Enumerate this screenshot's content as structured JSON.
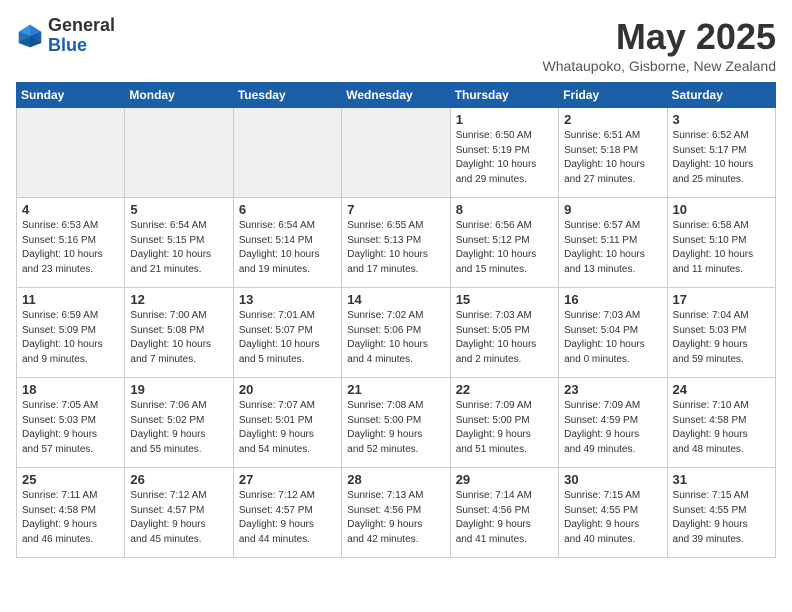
{
  "header": {
    "logo_general": "General",
    "logo_blue": "Blue",
    "month_title": "May 2025",
    "location": "Whataupoko, Gisborne, New Zealand"
  },
  "weekdays": [
    "Sunday",
    "Monday",
    "Tuesday",
    "Wednesday",
    "Thursday",
    "Friday",
    "Saturday"
  ],
  "weeks": [
    [
      {
        "day": "",
        "info": ""
      },
      {
        "day": "",
        "info": ""
      },
      {
        "day": "",
        "info": ""
      },
      {
        "day": "",
        "info": ""
      },
      {
        "day": "1",
        "info": "Sunrise: 6:50 AM\nSunset: 5:19 PM\nDaylight: 10 hours\nand 29 minutes."
      },
      {
        "day": "2",
        "info": "Sunrise: 6:51 AM\nSunset: 5:18 PM\nDaylight: 10 hours\nand 27 minutes."
      },
      {
        "day": "3",
        "info": "Sunrise: 6:52 AM\nSunset: 5:17 PM\nDaylight: 10 hours\nand 25 minutes."
      }
    ],
    [
      {
        "day": "4",
        "info": "Sunrise: 6:53 AM\nSunset: 5:16 PM\nDaylight: 10 hours\nand 23 minutes."
      },
      {
        "day": "5",
        "info": "Sunrise: 6:54 AM\nSunset: 5:15 PM\nDaylight: 10 hours\nand 21 minutes."
      },
      {
        "day": "6",
        "info": "Sunrise: 6:54 AM\nSunset: 5:14 PM\nDaylight: 10 hours\nand 19 minutes."
      },
      {
        "day": "7",
        "info": "Sunrise: 6:55 AM\nSunset: 5:13 PM\nDaylight: 10 hours\nand 17 minutes."
      },
      {
        "day": "8",
        "info": "Sunrise: 6:56 AM\nSunset: 5:12 PM\nDaylight: 10 hours\nand 15 minutes."
      },
      {
        "day": "9",
        "info": "Sunrise: 6:57 AM\nSunset: 5:11 PM\nDaylight: 10 hours\nand 13 minutes."
      },
      {
        "day": "10",
        "info": "Sunrise: 6:58 AM\nSunset: 5:10 PM\nDaylight: 10 hours\nand 11 minutes."
      }
    ],
    [
      {
        "day": "11",
        "info": "Sunrise: 6:59 AM\nSunset: 5:09 PM\nDaylight: 10 hours\nand 9 minutes."
      },
      {
        "day": "12",
        "info": "Sunrise: 7:00 AM\nSunset: 5:08 PM\nDaylight: 10 hours\nand 7 minutes."
      },
      {
        "day": "13",
        "info": "Sunrise: 7:01 AM\nSunset: 5:07 PM\nDaylight: 10 hours\nand 5 minutes."
      },
      {
        "day": "14",
        "info": "Sunrise: 7:02 AM\nSunset: 5:06 PM\nDaylight: 10 hours\nand 4 minutes."
      },
      {
        "day": "15",
        "info": "Sunrise: 7:03 AM\nSunset: 5:05 PM\nDaylight: 10 hours\nand 2 minutes."
      },
      {
        "day": "16",
        "info": "Sunrise: 7:03 AM\nSunset: 5:04 PM\nDaylight: 10 hours\nand 0 minutes."
      },
      {
        "day": "17",
        "info": "Sunrise: 7:04 AM\nSunset: 5:03 PM\nDaylight: 9 hours\nand 59 minutes."
      }
    ],
    [
      {
        "day": "18",
        "info": "Sunrise: 7:05 AM\nSunset: 5:03 PM\nDaylight: 9 hours\nand 57 minutes."
      },
      {
        "day": "19",
        "info": "Sunrise: 7:06 AM\nSunset: 5:02 PM\nDaylight: 9 hours\nand 55 minutes."
      },
      {
        "day": "20",
        "info": "Sunrise: 7:07 AM\nSunset: 5:01 PM\nDaylight: 9 hours\nand 54 minutes."
      },
      {
        "day": "21",
        "info": "Sunrise: 7:08 AM\nSunset: 5:00 PM\nDaylight: 9 hours\nand 52 minutes."
      },
      {
        "day": "22",
        "info": "Sunrise: 7:09 AM\nSunset: 5:00 PM\nDaylight: 9 hours\nand 51 minutes."
      },
      {
        "day": "23",
        "info": "Sunrise: 7:09 AM\nSunset: 4:59 PM\nDaylight: 9 hours\nand 49 minutes."
      },
      {
        "day": "24",
        "info": "Sunrise: 7:10 AM\nSunset: 4:58 PM\nDaylight: 9 hours\nand 48 minutes."
      }
    ],
    [
      {
        "day": "25",
        "info": "Sunrise: 7:11 AM\nSunset: 4:58 PM\nDaylight: 9 hours\nand 46 minutes."
      },
      {
        "day": "26",
        "info": "Sunrise: 7:12 AM\nSunset: 4:57 PM\nDaylight: 9 hours\nand 45 minutes."
      },
      {
        "day": "27",
        "info": "Sunrise: 7:12 AM\nSunset: 4:57 PM\nDaylight: 9 hours\nand 44 minutes."
      },
      {
        "day": "28",
        "info": "Sunrise: 7:13 AM\nSunset: 4:56 PM\nDaylight: 9 hours\nand 42 minutes."
      },
      {
        "day": "29",
        "info": "Sunrise: 7:14 AM\nSunset: 4:56 PM\nDaylight: 9 hours\nand 41 minutes."
      },
      {
        "day": "30",
        "info": "Sunrise: 7:15 AM\nSunset: 4:55 PM\nDaylight: 9 hours\nand 40 minutes."
      },
      {
        "day": "31",
        "info": "Sunrise: 7:15 AM\nSunset: 4:55 PM\nDaylight: 9 hours\nand 39 minutes."
      }
    ]
  ]
}
